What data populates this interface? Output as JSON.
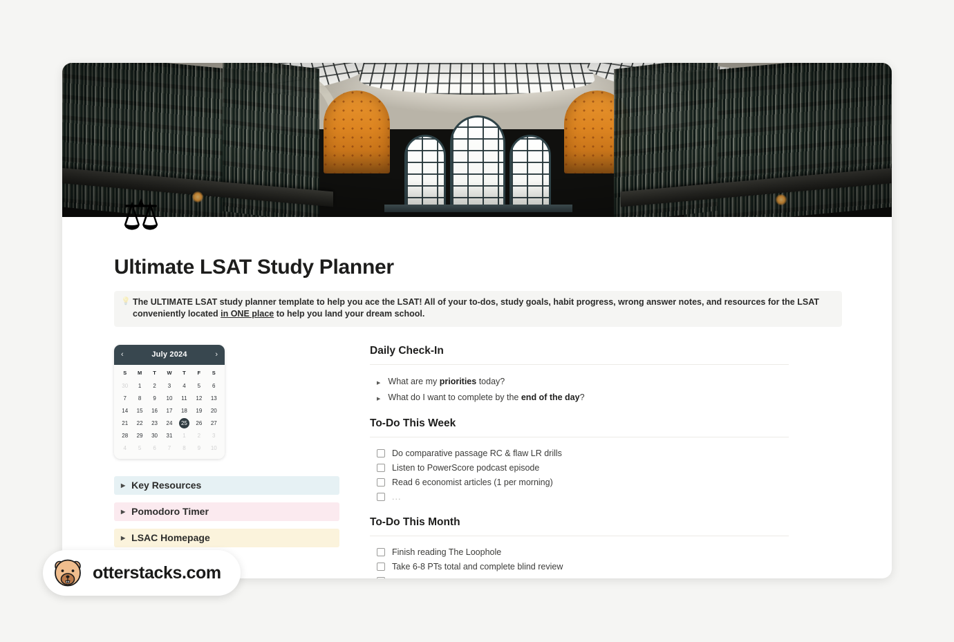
{
  "page": {
    "icon": "scales-of-justice-emoji",
    "title": "Ultimate LSAT Study Planner",
    "cover_alt": "library-interior-cover-photo"
  },
  "callout": {
    "icon": "light-bulb-icon",
    "text_before": "The ULTIMATE LSAT study planner template to help you ace the LSAT! All of your to-dos, study goals, habit progress, wrong answer notes, and resources for the LSAT conveniently located ",
    "text_underlined": "in ONE place",
    "text_after": " to help you land your dream school."
  },
  "calendar": {
    "prev_label": "‹",
    "next_label": "›",
    "month_label": "July 2024",
    "weekdays": [
      "S",
      "M",
      "T",
      "W",
      "T",
      "F",
      "S"
    ],
    "selected_day": 25,
    "days": [
      {
        "n": "30",
        "muted": true
      },
      {
        "n": "1"
      },
      {
        "n": "2"
      },
      {
        "n": "3"
      },
      {
        "n": "4"
      },
      {
        "n": "5"
      },
      {
        "n": "6"
      },
      {
        "n": "7"
      },
      {
        "n": "8"
      },
      {
        "n": "9"
      },
      {
        "n": "10"
      },
      {
        "n": "11"
      },
      {
        "n": "12"
      },
      {
        "n": "13"
      },
      {
        "n": "14"
      },
      {
        "n": "15"
      },
      {
        "n": "16"
      },
      {
        "n": "17"
      },
      {
        "n": "18"
      },
      {
        "n": "19"
      },
      {
        "n": "20"
      },
      {
        "n": "21"
      },
      {
        "n": "22"
      },
      {
        "n": "23"
      },
      {
        "n": "24"
      },
      {
        "n": "25",
        "selected": true
      },
      {
        "n": "26"
      },
      {
        "n": "27"
      },
      {
        "n": "28"
      },
      {
        "n": "29"
      },
      {
        "n": "30"
      },
      {
        "n": "31"
      },
      {
        "n": "1",
        "muted": true
      },
      {
        "n": "2",
        "muted": true
      },
      {
        "n": "3",
        "muted": true
      },
      {
        "n": "4",
        "muted": true
      },
      {
        "n": "5",
        "muted": true
      },
      {
        "n": "6",
        "muted": true
      },
      {
        "n": "7",
        "muted": true
      },
      {
        "n": "8",
        "muted": true
      },
      {
        "n": "9",
        "muted": true
      },
      {
        "n": "10",
        "muted": true
      }
    ]
  },
  "toggles": [
    {
      "label": "Key Resources",
      "color": "#e6f1f4",
      "class": "t-blue"
    },
    {
      "label": "Pomodoro Timer",
      "color": "#fbeaef",
      "class": "t-pink"
    },
    {
      "label": "LSAC Homepage",
      "color": "#fbf3dc",
      "class": "t-yellow"
    }
  ],
  "daily_checkin": {
    "heading": "Daily Check-In",
    "items": [
      {
        "before": "What are my ",
        "bold": "priorities",
        "after": " today?"
      },
      {
        "before": "What do I want to complete by the ",
        "bold": "end of the day",
        "after": "?"
      }
    ]
  },
  "todo_week": {
    "heading": "To-Do This Week",
    "items": [
      {
        "label": "Do comparative passage RC & flaw LR drills",
        "checked": false
      },
      {
        "label": "Listen to PowerScore podcast episode",
        "checked": false
      },
      {
        "label": "Read 6 economist articles (1 per morning)",
        "checked": false
      },
      {
        "label": "...",
        "checked": false,
        "placeholder": true
      }
    ]
  },
  "todo_month": {
    "heading": "To-Do This Month",
    "items": [
      {
        "label": "Finish reading The Loophole",
        "checked": false
      },
      {
        "label": "Take 6-8 PTs total and complete blind review",
        "checked": false
      },
      {
        "label": "...",
        "checked": false,
        "placeholder": true
      }
    ]
  },
  "watermark": {
    "text": "otterstacks.com",
    "logo": "otter-avatar-icon"
  }
}
